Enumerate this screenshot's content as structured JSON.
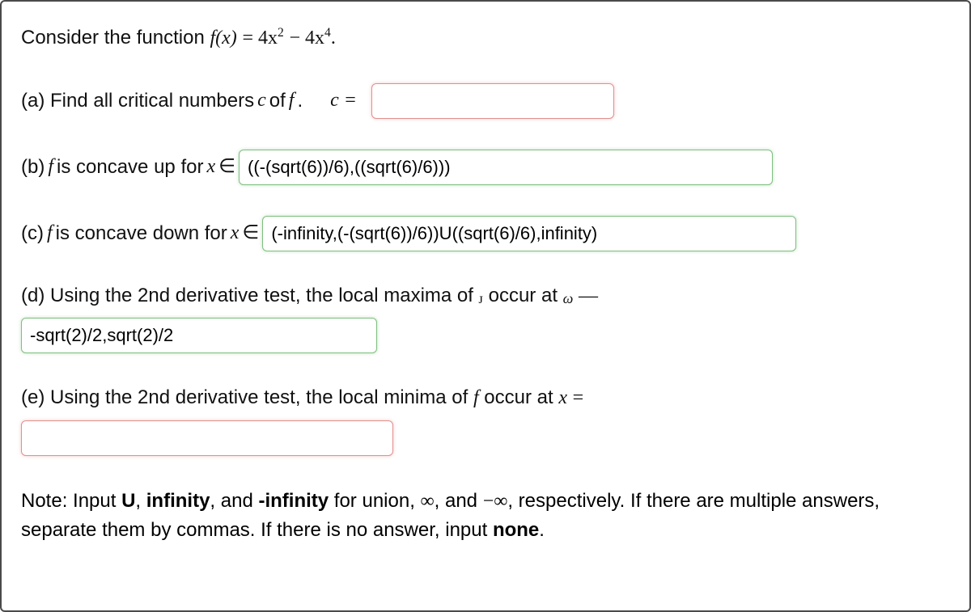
{
  "intro": {
    "prefix": "Consider the function ",
    "fn_fx": "f(x)",
    "eq": " = ",
    "expr_a": "4x",
    "sup2": "2",
    "minus": " − ",
    "expr_b": "4x",
    "sup4": "4",
    "period": "."
  },
  "a": {
    "label": "(a) Find all critical numbers ",
    "c": "c",
    "of_f": " of ",
    "f": "f",
    "dot": ".",
    "c_eq": "c =",
    "value": ""
  },
  "b": {
    "label_pre": "(b) ",
    "f": "f",
    "label_mid": " is concave up for ",
    "x": "x",
    "in": " ∈ ",
    "value": "((-(sqrt(6))/6),((sqrt(6)/6)))"
  },
  "c": {
    "label_pre": "(c) ",
    "f": "f",
    "label_mid": " is concave down for ",
    "x": "x",
    "in": " ∈ ",
    "value": "(-infinity,(-(sqrt(6))/6))U((sqrt(6)/6),infinity)"
  },
  "d": {
    "label_pre": "(d) Using the 2nd derivative test, the local maxima of ",
    "j": "ᴊ",
    "label_mid": " occur at ",
    "w": "ω",
    "dash": " —",
    "value": "-sqrt(2)/2,sqrt(2)/2"
  },
  "e": {
    "label_pre": "(e) Using the 2nd derivative test, the local minima of ",
    "f": "f",
    "label_mid": " occur at ",
    "x": "x",
    "eq": " =",
    "value": ""
  },
  "note": {
    "pre": "Note: Input ",
    "u": "U",
    "c1": ", ",
    "inf": "infinity",
    "c2": ", and ",
    "ninf": "-infinity",
    "mid1": " for union, ",
    "infSym": "∞",
    "c3": ", and ",
    "ninfSym": "−∞",
    "mid2": ", respectively. If there are multiple answers, separate them by commas. If there is no answer, input ",
    "none": "none",
    "dot": "."
  }
}
